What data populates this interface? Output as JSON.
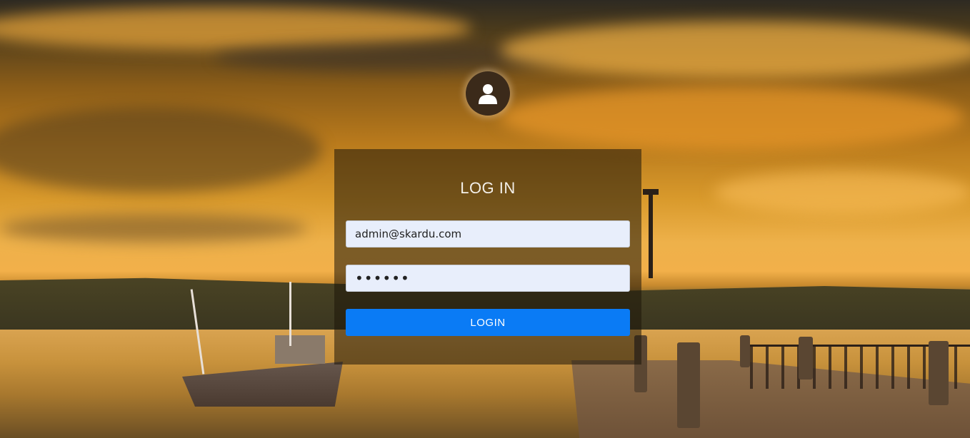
{
  "login": {
    "title": "LOG IN",
    "email_value": "admin@skardu.com",
    "password_value": "••••••",
    "submit_label": "LOGIN"
  },
  "icons": {
    "avatar": "user-icon"
  },
  "colors": {
    "button": "#0a7bf5",
    "input_bg": "#e8eefb",
    "avatar_bg": "#3b2a1a"
  }
}
